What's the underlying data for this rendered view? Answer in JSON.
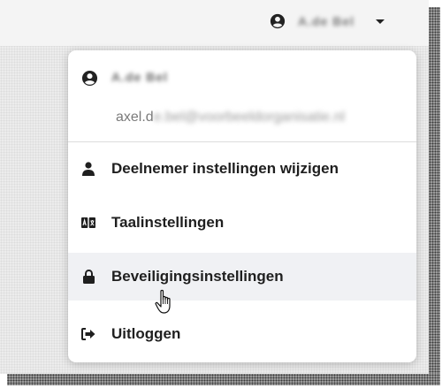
{
  "topbar": {
    "user_name": "A.de Bel",
    "icons": {
      "user": "user-circle-icon",
      "caret": "caret-down-icon"
    }
  },
  "menu": {
    "header": {
      "name": "A.de Bel",
      "email_prefix": "axel.d",
      "email_rest": "e.bel@voorbeeldorganisatie.nl"
    },
    "items": [
      {
        "label": "Deelnemer instellingen wijzigen",
        "icon": "user-icon"
      },
      {
        "label": "Taalinstellingen",
        "icon": "language-icon"
      },
      {
        "label": "Beveiligingsinstellingen",
        "icon": "lock-icon"
      },
      {
        "label": "Uitloggen",
        "icon": "sign-out-icon"
      }
    ]
  },
  "colors": {
    "accent_text": "#1f1f1f",
    "hover_bg": "#f0f1f4"
  }
}
